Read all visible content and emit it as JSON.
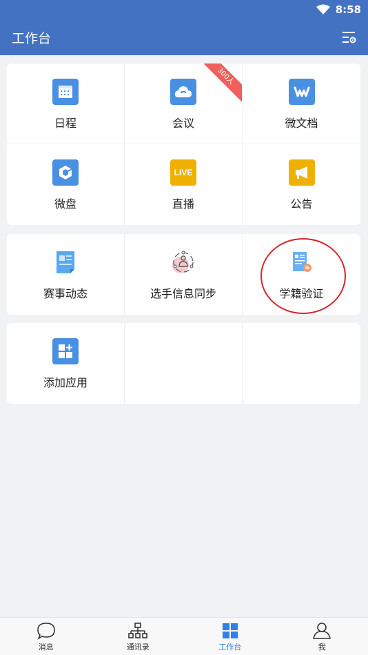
{
  "status": {
    "time": "8:58"
  },
  "header": {
    "title": "工作台"
  },
  "section1": [
    {
      "label": "日程",
      "icon": "calendar-icon",
      "color": "#4a90e2"
    },
    {
      "label": "会议",
      "icon": "cloud-phone-icon",
      "color": "#4a90e2",
      "badge": "300人"
    },
    {
      "label": "微文档",
      "icon": "doc-w-icon",
      "color": "#4a90e2"
    },
    {
      "label": "微盘",
      "icon": "cube-icon",
      "color": "#4a90e2"
    },
    {
      "label": "直播",
      "icon": "live-icon",
      "color": "#f0b000",
      "icon_text": "LIVE"
    },
    {
      "label": "公告",
      "icon": "megaphone-icon",
      "color": "#f0b000"
    }
  ],
  "section2": [
    {
      "label": "赛事动态",
      "icon": "news-icon"
    },
    {
      "label": "选手信息同步",
      "icon": "sync-user-icon"
    },
    {
      "label": "学籍验证",
      "icon": "id-card-icon"
    }
  ],
  "section3": [
    {
      "label": "添加应用",
      "icon": "add-app-icon",
      "color": "#4a90e2"
    }
  ],
  "tabs": [
    {
      "label": "消息",
      "icon": "chat-icon"
    },
    {
      "label": "通讯录",
      "icon": "org-chart-icon"
    },
    {
      "label": "工作台",
      "icon": "grid-icon",
      "active": true
    },
    {
      "label": "我",
      "icon": "person-icon"
    }
  ]
}
